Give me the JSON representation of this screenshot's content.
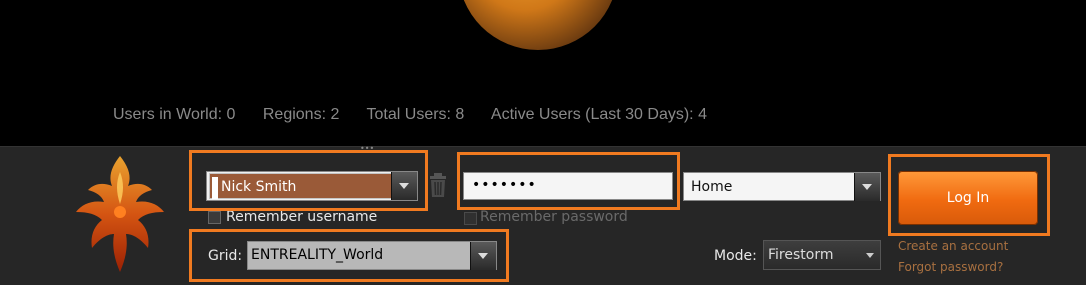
{
  "stats": {
    "users_in_world": "Users in World: 0",
    "regions": "Regions: 2",
    "total_users": "Total Users: 8",
    "active_users": "Active Users (Last 30 Days): 4"
  },
  "login": {
    "username": "Nick Smith",
    "password_mask": "•••••••",
    "remember_username": "Remember username",
    "remember_password": "Remember password",
    "start_location": "Home",
    "login_button": "Log In",
    "grid_label": "Grid:",
    "grid_value": "ENTREALITY_World",
    "mode_label": "Mode:",
    "mode_value": "Firestorm",
    "create_account": "Create an account",
    "forgot_password": "Forgot password?"
  },
  "colors": {
    "highlight": "#f07a20",
    "login_button": "#f06a10",
    "link": "#a87040"
  },
  "icons": {
    "logo": "phoenix-logo-icon",
    "trash": "trash-icon"
  }
}
